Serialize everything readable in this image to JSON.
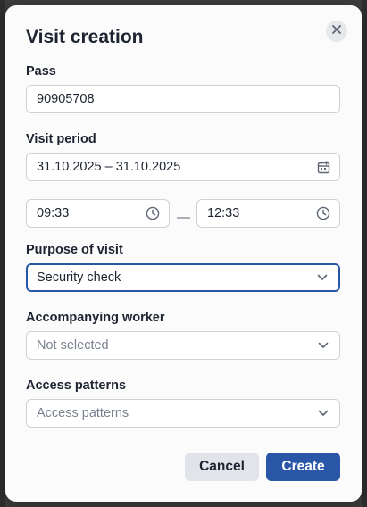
{
  "dialog": {
    "title": "Visit creation",
    "close_icon": "close-icon"
  },
  "pass": {
    "label": "Pass",
    "value": "90905708"
  },
  "visit_period": {
    "label": "Visit period",
    "date_range": "31.10.2025 – 31.10.2025",
    "date_icon": "calendar-icon",
    "time_from": "09:33",
    "time_to": "12:33",
    "separator": "—",
    "time_icon": "clock-icon"
  },
  "purpose": {
    "label": "Purpose of visit",
    "selected": "Security check",
    "icon": "chevron-down-icon"
  },
  "accompanying_worker": {
    "label": "Accompanying worker",
    "placeholder": "Not selected",
    "icon": "chevron-down-icon"
  },
  "access_patterns": {
    "label": "Access patterns",
    "placeholder": "Access patterns",
    "icon": "chevron-down-icon"
  },
  "actions": {
    "cancel_label": "Cancel",
    "create_label": "Create"
  },
  "colors": {
    "primary": "#2a56a8",
    "focus_border": "#2a56a8",
    "secondary_button": "#e1e4e9",
    "text": "#1d2330"
  }
}
